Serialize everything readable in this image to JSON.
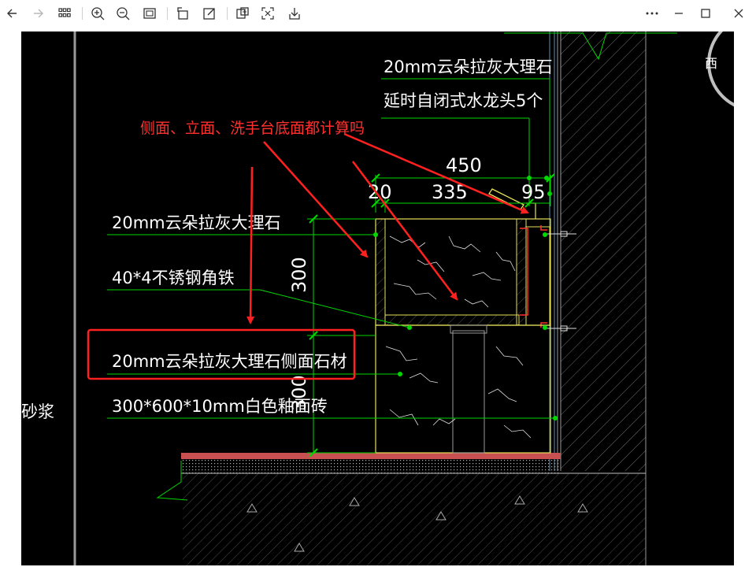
{
  "toolbar": {
    "left_icons": [
      "back-arrow-icon",
      "forward-arrow-icon",
      "grid-view-icon",
      "zoom-in-icon",
      "zoom-out-icon",
      "fit-screen-icon",
      "rotate-icon",
      "edit-icon",
      "crop-icon",
      "expand-icon",
      "save-icon"
    ],
    "right_icons": [
      "more-icon",
      "minimize-icon",
      "maximize-icon",
      "close-icon"
    ]
  },
  "colors": {
    "background": "#000000",
    "leader": "#00d800",
    "outline": "#e6e05a",
    "annotation": "#ff2020",
    "highlight_box": "#ff2020"
  },
  "drawing": {
    "direction_label": "西",
    "labels": {
      "top_marble": "20mm云朵拉灰大理石",
      "faucet": "延时自闭式水龙头5个",
      "left_marble": "20mm云朵拉灰大理石",
      "angle_iron": "40*4不锈钢角铁",
      "side_marble": "20mm云朵拉灰大理石侧面石材",
      "tile": "300*600*10mm白色釉面砖",
      "mortar": "砂浆"
    },
    "dimensions": {
      "width_total": "450",
      "left_thick": "20",
      "middle": "335",
      "right": "95",
      "height_upper": "300",
      "height_lower": "300"
    },
    "question": "侧面、立面、洗手台底面都计算吗"
  }
}
